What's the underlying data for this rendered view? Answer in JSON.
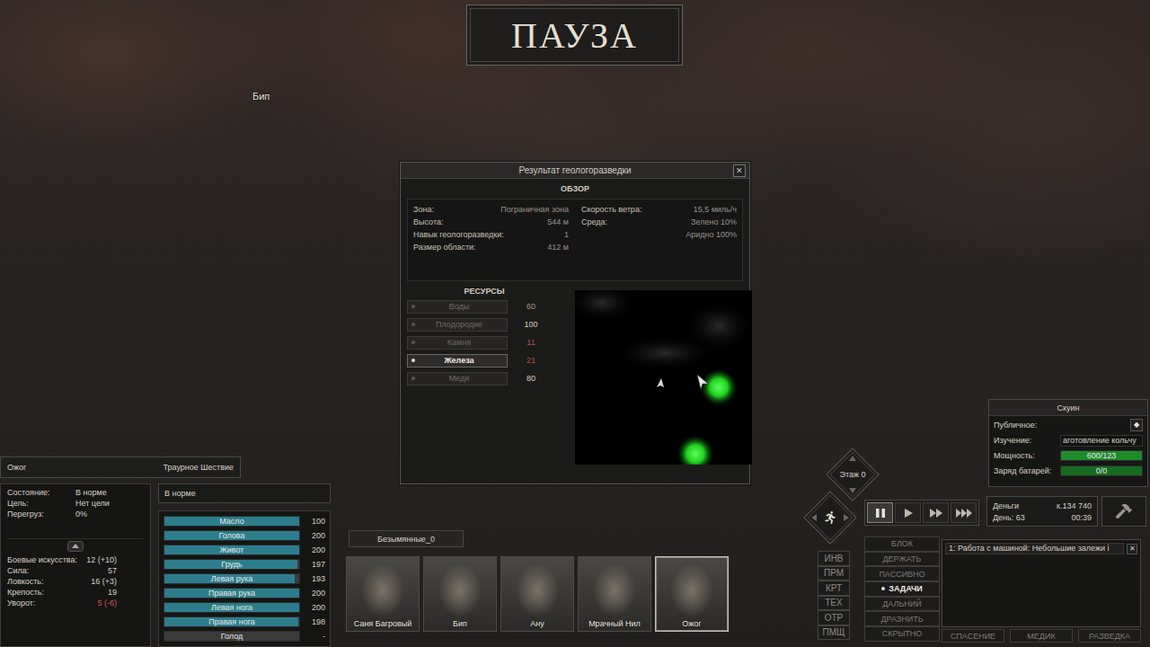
{
  "pause": {
    "label": "ПАУЗА"
  },
  "world_labels": [
    {
      "text": "Бип"
    }
  ],
  "dialog": {
    "title": "Результат геологоразведки",
    "close": "✕",
    "overview_title": "ОБЗОР",
    "overview_left": [
      {
        "label": "Зона:",
        "value": "Пограничная зона"
      },
      {
        "label": "Высота:",
        "value": "544 м"
      },
      {
        "label": "Навык геологоразведки:",
        "value": "1"
      },
      {
        "label": "Размер области:",
        "value": "412 м"
      }
    ],
    "overview_right": [
      {
        "label": "Скорость ветра:",
        "value": "15,5 миль/ч"
      },
      {
        "label": "Среда:",
        "value": "Зелено 10%"
      },
      {
        "label": "",
        "value": "Аридно 100%"
      }
    ],
    "resources_title": "РЕСУРСЫ",
    "resources": [
      {
        "name": "Воды",
        "value": "60",
        "selected": false,
        "color": "#a59c88"
      },
      {
        "name": "Плодородие",
        "value": "100",
        "selected": false,
        "color": "#d8d0bf"
      },
      {
        "name": "Камня",
        "value": "11",
        "selected": false,
        "color": "#c0504a"
      },
      {
        "name": "Железа",
        "value": "21",
        "selected": true,
        "color": "#c0504a"
      },
      {
        "name": "Меди",
        "value": "80",
        "selected": false,
        "color": "#d8d0bf"
      }
    ]
  },
  "character": {
    "name": "Ожог",
    "faction": "Траурное Шествие",
    "info": [
      {
        "label": "Состояние:",
        "value": "В норме"
      },
      {
        "label": "Цель:",
        "value": "Нет цели"
      },
      {
        "label": "Перегруз:",
        "value": "0%"
      }
    ],
    "condition": "В норме",
    "body": [
      {
        "name": "Масло",
        "value": "100",
        "level": 1
      },
      {
        "name": "Голова",
        "value": "200",
        "level": 1
      },
      {
        "name": "Живот",
        "value": "200",
        "level": 1
      },
      {
        "name": "Грудь",
        "value": "197",
        "level": 0.985
      },
      {
        "name": "Левая рука",
        "value": "193",
        "level": 0.965
      },
      {
        "name": "Правая рука",
        "value": "200",
        "level": 1
      },
      {
        "name": "Левая нога",
        "value": "200",
        "level": 1
      },
      {
        "name": "Правая нога",
        "value": "198",
        "level": 0.99
      },
      {
        "name": "Голод",
        "value": "-",
        "level": 0
      }
    ],
    "stats": [
      {
        "label": "Боевые искусства:",
        "value": "12 (+10)",
        "color": "#d8d2c4"
      },
      {
        "label": "Сила:",
        "value": "57",
        "color": "#d8d2c4"
      },
      {
        "label": "Ловкость:",
        "value": "16 (+3)",
        "color": "#d8d2c4"
      },
      {
        "label": "Крепость:",
        "value": "19",
        "color": "#d8d2c4"
      },
      {
        "label": "Уворот:",
        "value": "5 (-6)",
        "color": "#d9534f"
      }
    ]
  },
  "squad": {
    "tab": "Безымянные_0",
    "members": [
      {
        "name": "Саня Багровый",
        "selected": false
      },
      {
        "name": "Бип",
        "selected": false
      },
      {
        "name": "Ану",
        "selected": false
      },
      {
        "name": "Мрачный Нил",
        "selected": false
      },
      {
        "name": "Ожог",
        "selected": true
      }
    ]
  },
  "side_buttons": [
    "ИНВ",
    "ПРМ",
    "КРТ",
    "ТЕХ",
    "ОТР",
    "ПМЩ"
  ],
  "floor": {
    "label": "Этаж 0"
  },
  "speed": [
    {
      "kind": "pause",
      "selected": true
    },
    {
      "kind": "play",
      "selected": false
    },
    {
      "kind": "fast",
      "selected": false
    },
    {
      "kind": "faster",
      "selected": false
    }
  ],
  "money": {
    "label": "Деньги",
    "value": "к.134 740",
    "day_label": "День:",
    "day": "63",
    "time": "00:39"
  },
  "building": {
    "title": "Скуин",
    "rows": [
      {
        "kind": "toggle",
        "label": "Публичное:",
        "value": "◆"
      },
      {
        "kind": "text",
        "label": "Изучение:",
        "value": "аготовление кольчу"
      },
      {
        "kind": "bar",
        "label": "Мощность:",
        "value": "600/123",
        "level": 1
      },
      {
        "kind": "bar",
        "label": "Заряд батарей:",
        "value": "0/0",
        "level": 1
      }
    ]
  },
  "ai_buttons": [
    {
      "label": "БЛОК",
      "selected": false
    },
    {
      "label": "ДЕРЖАТЬ",
      "selected": false
    },
    {
      "label": "ПАССИВНО",
      "selected": false
    },
    {
      "label": "ЗАДАЧИ",
      "selected": true
    },
    {
      "label": "ДАЛЬНИЙ",
      "selected": false
    },
    {
      "label": "ДРАЗНИТЬ",
      "selected": false
    },
    {
      "label": "СКРЫТНО",
      "selected": false
    }
  ],
  "job_buttons": [
    "СПАСЕНИЕ",
    "МЕДИК",
    "РАЗВЕДКА"
  ],
  "tasks": [
    {
      "text": "1: Работа с машиной: Небольшие залежи і",
      "remove": "✕"
    }
  ]
}
